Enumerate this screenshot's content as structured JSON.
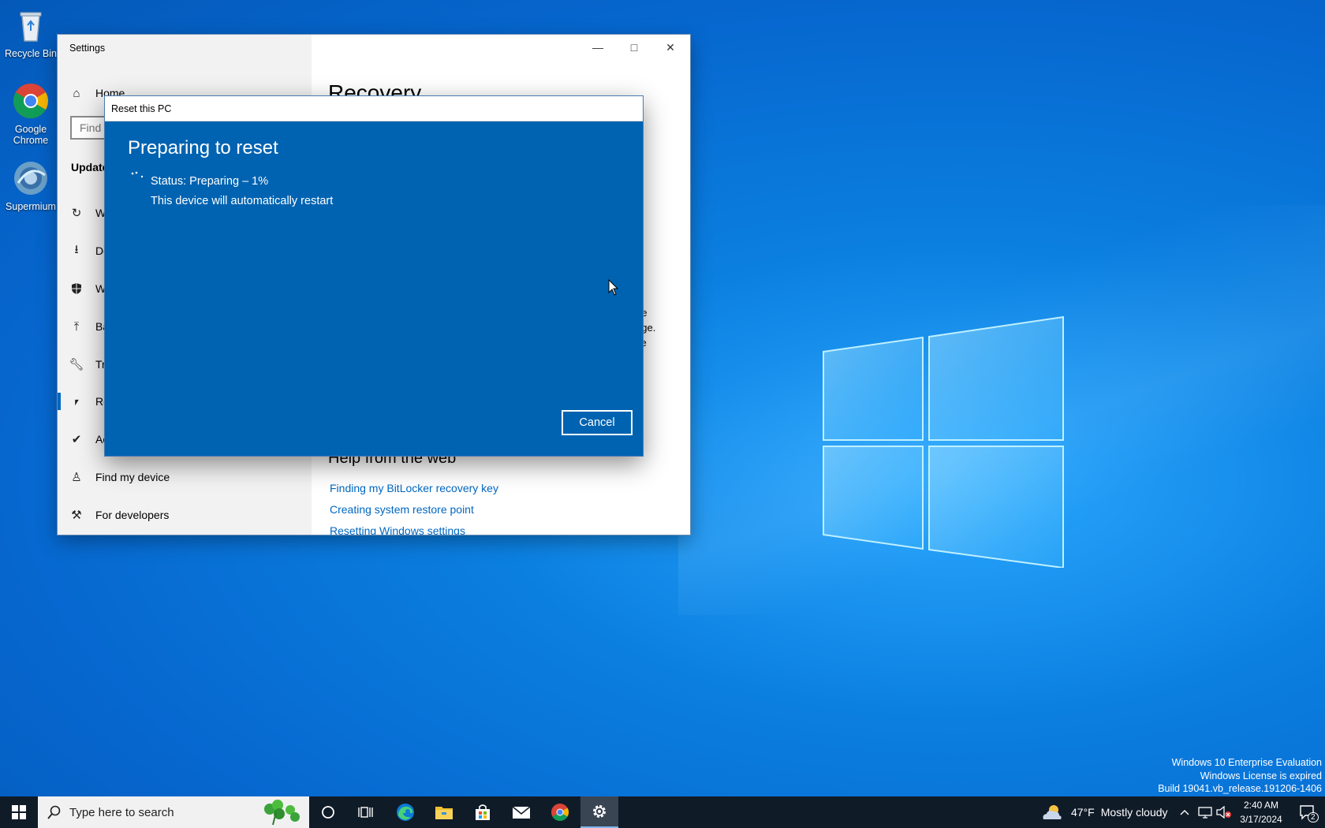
{
  "desktop": {
    "icons": [
      {
        "label": "Recycle Bin"
      },
      {
        "label": "Google Chrome"
      },
      {
        "label": "Supermium"
      }
    ],
    "watermark": {
      "line1": "Windows 10 Enterprise Evaluation",
      "line2": "Windows License is expired",
      "line3": "Build 19041.vb_release.191206-1406"
    }
  },
  "settings": {
    "title": "Settings",
    "nav": {
      "home": "Home",
      "search_placeholder": "Find",
      "category": "Update",
      "items": [
        {
          "label": "W"
        },
        {
          "label": "De"
        },
        {
          "label": "W"
        },
        {
          "label": "Ba"
        },
        {
          "label": "Tr"
        },
        {
          "label": "Re"
        },
        {
          "label": "Ac"
        },
        {
          "label": "Find my device"
        },
        {
          "label": "For developers"
        }
      ]
    },
    "page_title": "Recovery",
    "fragments": [
      "ge",
      "age.",
      "se"
    ],
    "help": {
      "title": "Help from the web",
      "links": [
        "Finding my BitLocker recovery key",
        "Creating system restore point",
        "Resetting Windows settings"
      ]
    }
  },
  "dialog": {
    "title": "Reset this PC",
    "heading": "Preparing to reset",
    "status": "Status: Preparing – 1%",
    "progress_percent": 1,
    "note": "This device will automatically restart",
    "cancel_label": "Cancel",
    "background_color": "#0063b1"
  },
  "taskbar": {
    "search_placeholder": "Type here to search",
    "weather": {
      "temp": "47°F",
      "condition": "Mostly cloudy"
    },
    "clock": {
      "time": "2:40 AM",
      "date": "3/17/2024"
    },
    "notification_count": "2",
    "pinned": [
      "cortana-icon",
      "task-view-icon",
      "edge-icon",
      "file-explorer-icon",
      "store-icon",
      "mail-icon",
      "chrome-icon",
      "settings-icon"
    ]
  }
}
